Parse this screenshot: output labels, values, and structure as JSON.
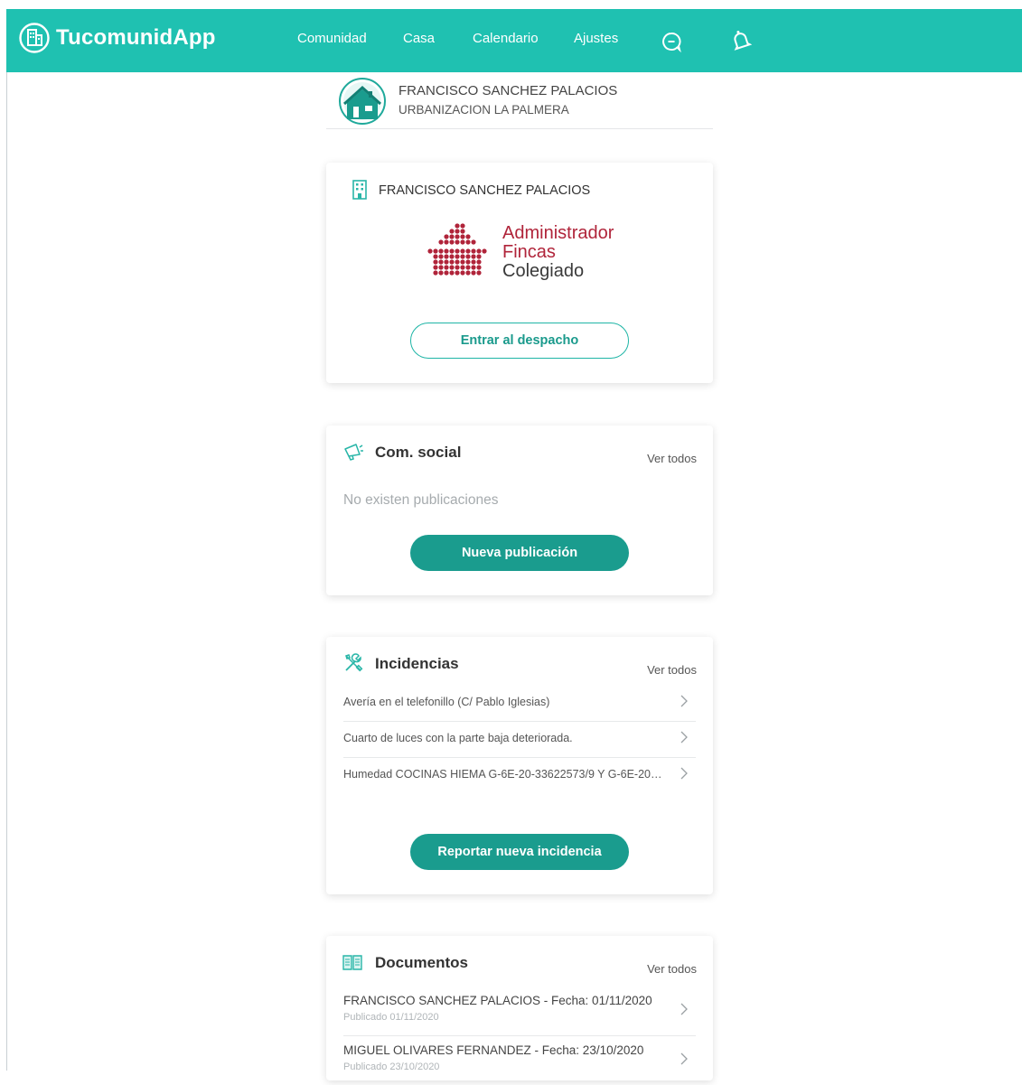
{
  "app": {
    "brand": "TucomunidApp"
  },
  "nav": {
    "items": [
      "Comunidad",
      "Casa",
      "Calendario",
      "Ajustes"
    ],
    "chat_icon": "chat-bubble-icon",
    "bell_icon": "bell-icon"
  },
  "profile": {
    "name": "FRANCISCO SANCHEZ PALACIOS",
    "community": "URBANIZACION LA PALMERA"
  },
  "admin_card": {
    "title": "FRANCISCO SANCHEZ PALACIOS",
    "logo_lines": [
      "Administrador",
      "Fincas",
      "Colegiado"
    ],
    "button": "Entrar al despacho"
  },
  "social_card": {
    "title": "Com. social",
    "ver_todos": "Ver todos",
    "empty": "No existen publicaciones",
    "button": "Nueva publicación"
  },
  "incidencias_card": {
    "title": "Incidencias",
    "ver_todos": "Ver todos",
    "items": [
      "Avería en el telefonillo (C/ Pablo Iglesias)",
      "Cuarto de luces con la parte baja deteriorada.",
      "Humedad COCINAS HIEMA G-6E-20-33622573/9 Y G-6E-20-3..."
    ],
    "button": "Reportar nueva incidencia"
  },
  "documentos_card": {
    "title": "Documentos",
    "ver_todos": "Ver todos",
    "items": [
      {
        "title": "FRANCISCO SANCHEZ PALACIOS - Fecha: 01/11/2020",
        "sub": "Publicado 01/11/2020"
      },
      {
        "title": "MIGUEL OLIVARES FERNANDEZ - Fecha: 23/10/2020",
        "sub": "Publicado 23/10/2020"
      }
    ]
  },
  "colors": {
    "primary": "#1fc1b1",
    "button": "#1a9c8e",
    "logo_red": "#b0243a"
  }
}
